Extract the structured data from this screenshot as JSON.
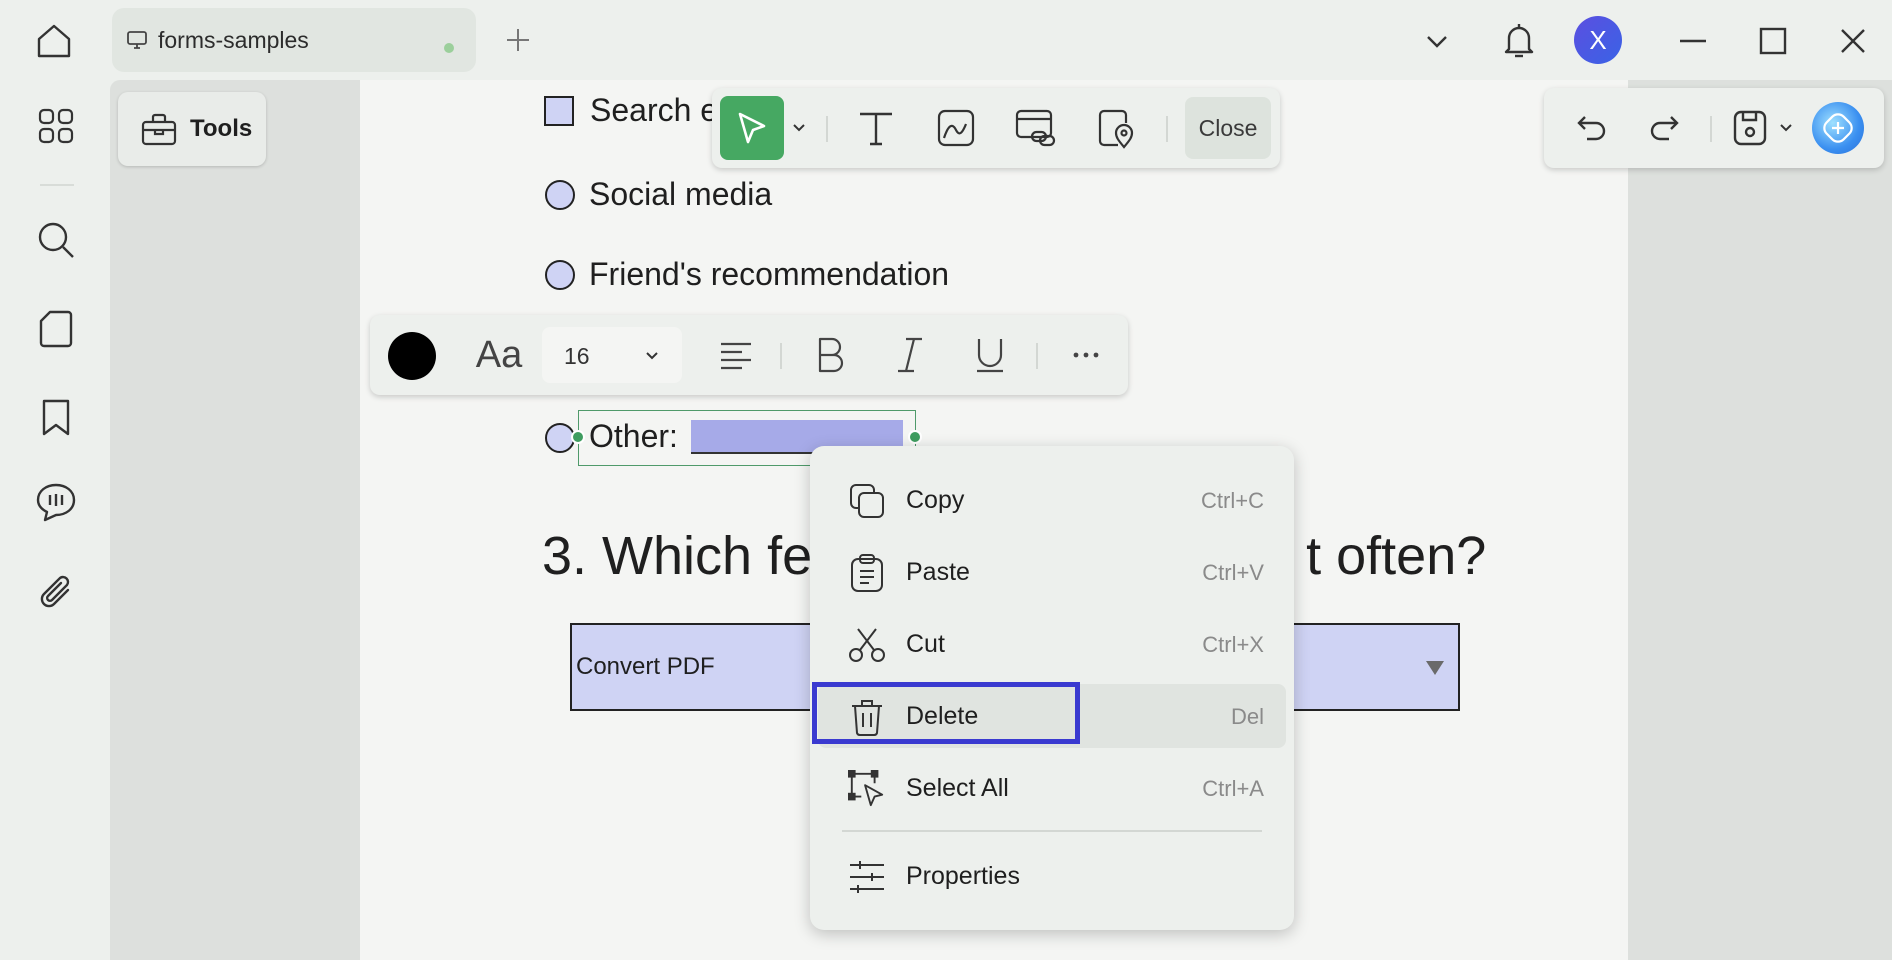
{
  "titlebar": {
    "tab_title": "forms-samples",
    "avatar_letter": "X"
  },
  "tools": {
    "label": "Tools"
  },
  "form": {
    "options": [
      "Search e",
      "Social media",
      "Friend's recommendation"
    ],
    "other_label": "Other:",
    "question": "3. Which fea",
    "question_tail": "t often?",
    "dropdown_value": "Convert PDF"
  },
  "floating_toolbar": {
    "close_label": "Close"
  },
  "text_toolbar": {
    "font_size": "16",
    "color": "#000000"
  },
  "context_menu": {
    "items": [
      {
        "label": "Copy",
        "shortcut": "Ctrl+C"
      },
      {
        "label": "Paste",
        "shortcut": "Ctrl+V"
      },
      {
        "label": "Cut",
        "shortcut": "Ctrl+X"
      },
      {
        "label": "Delete",
        "shortcut": "Del"
      },
      {
        "label": "Select All",
        "shortcut": "Ctrl+A"
      },
      {
        "label": "Properties",
        "shortcut": ""
      }
    ],
    "highlighted": "Delete"
  },
  "colors": {
    "accent_green": "#46a862",
    "focus_blue": "#3a3ad0",
    "field_fill": "#cfd3f4",
    "avatar": "#4f55e0"
  }
}
